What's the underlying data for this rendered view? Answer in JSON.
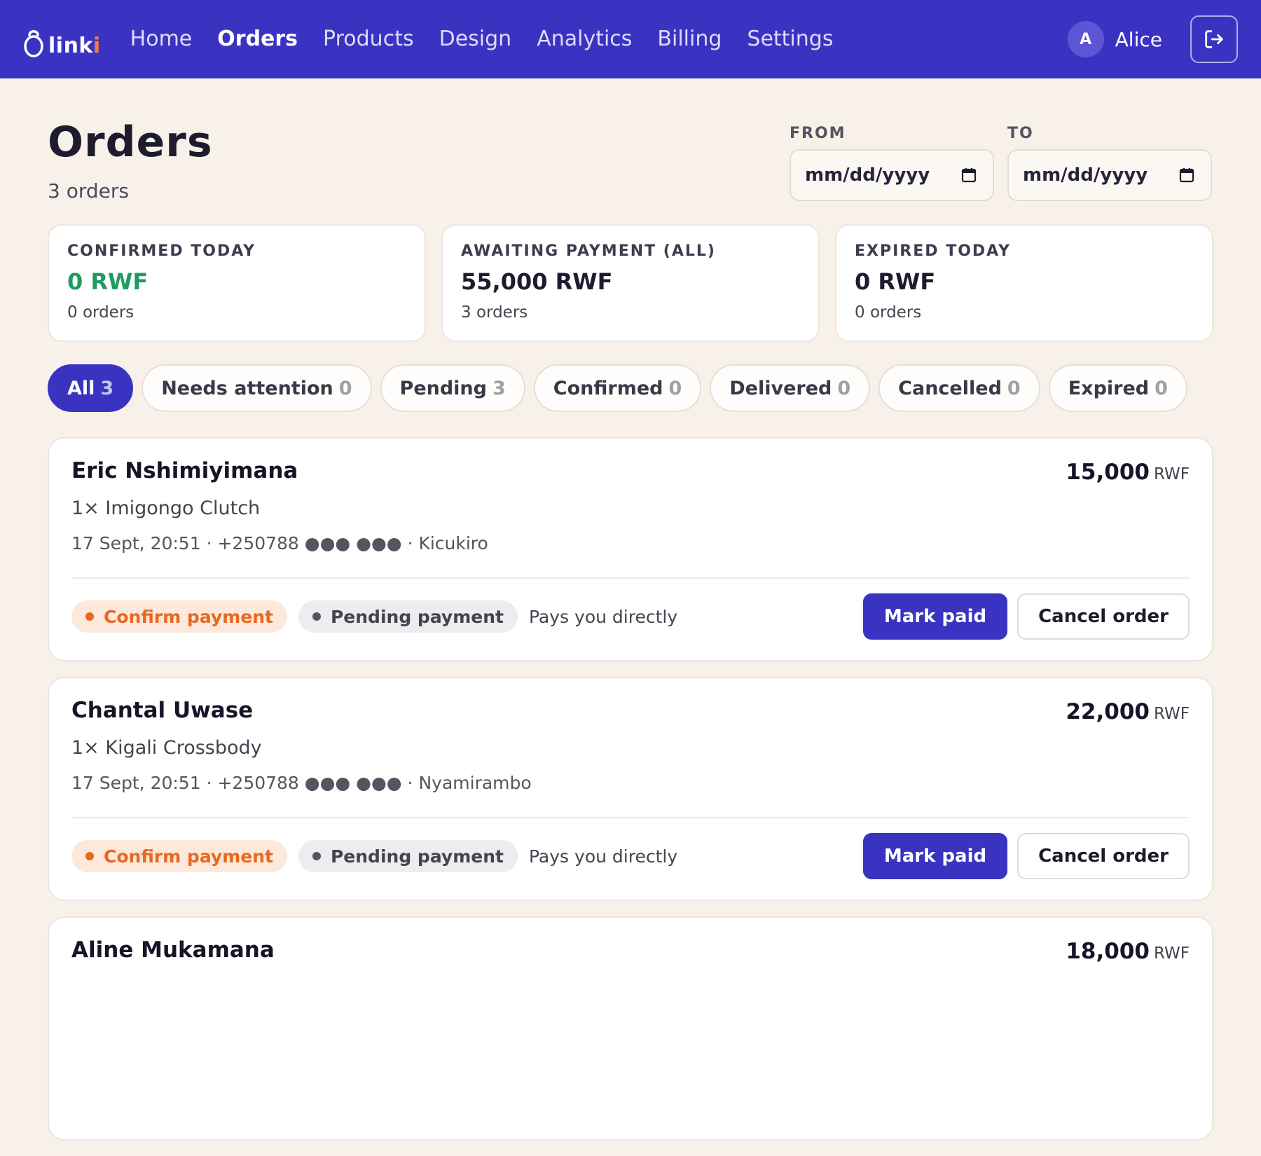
{
  "nav": {
    "brand_main": "link",
    "brand_accent": "i",
    "links": [
      {
        "label": "Home",
        "active": false
      },
      {
        "label": "Orders",
        "active": true
      },
      {
        "label": "Products",
        "active": false
      },
      {
        "label": "Design",
        "active": false
      },
      {
        "label": "Analytics",
        "active": false
      },
      {
        "label": "Billing",
        "active": false
      },
      {
        "label": "Settings",
        "active": false
      }
    ],
    "user_initial": "A",
    "user_name": "Alice"
  },
  "header": {
    "title": "Orders",
    "subtitle": "3 orders"
  },
  "date_filter": {
    "from_label": "FROM",
    "from_value": "mm/dd/yyyy",
    "to_label": "TO",
    "to_value": "mm/dd/yyyy"
  },
  "stats": [
    {
      "label": "CONFIRMED TODAY",
      "value": "0 RWF",
      "count": "0 orders",
      "color": "#1e9b62"
    },
    {
      "label": "AWAITING PAYMENT (ALL)",
      "value": "55,000 RWF",
      "count": "3 orders"
    },
    {
      "label": "EXPIRED TODAY",
      "value": "0 RWF",
      "count": "0 orders"
    }
  ],
  "tabs": [
    {
      "label": "All",
      "count": "3",
      "active": true
    },
    {
      "label": "Needs attention",
      "count": "0"
    },
    {
      "label": "Pending",
      "count": "3"
    },
    {
      "label": "Confirmed",
      "count": "0"
    },
    {
      "label": "Delivered",
      "count": "0"
    },
    {
      "label": "Cancelled",
      "count": "0"
    },
    {
      "label": "Expired",
      "count": "0"
    }
  ],
  "orders": [
    {
      "customer": "Eric Nshimiyimana",
      "amount": "15,000",
      "currency": "RWF",
      "items": "1× Imigongo Clutch",
      "meta": "17 Sept, 20:51 · +250788 ●●● ●●● · Kicukiro",
      "badge_action": "Confirm payment",
      "badge_status": "Pending payment",
      "note": "Pays you directly",
      "primary_btn": "Mark paid",
      "secondary_btn": "Cancel order"
    },
    {
      "customer": "Chantal Uwase",
      "amount": "22,000",
      "currency": "RWF",
      "items": "1× Kigali Crossbody",
      "meta": "17 Sept, 20:51 · +250788 ●●● ●●● · Nyamirambo",
      "badge_action": "Confirm payment",
      "badge_status": "Pending payment",
      "note": "Pays you directly",
      "primary_btn": "Mark paid",
      "secondary_btn": "Cancel order"
    },
    {
      "customer": "Aline Mukamana",
      "amount": "18,000",
      "currency": "RWF"
    }
  ],
  "colors": {
    "brand": "#3a33c2",
    "accent": "#ff7a3c",
    "warning": "#e8681f",
    "success": "#1e9b62"
  }
}
